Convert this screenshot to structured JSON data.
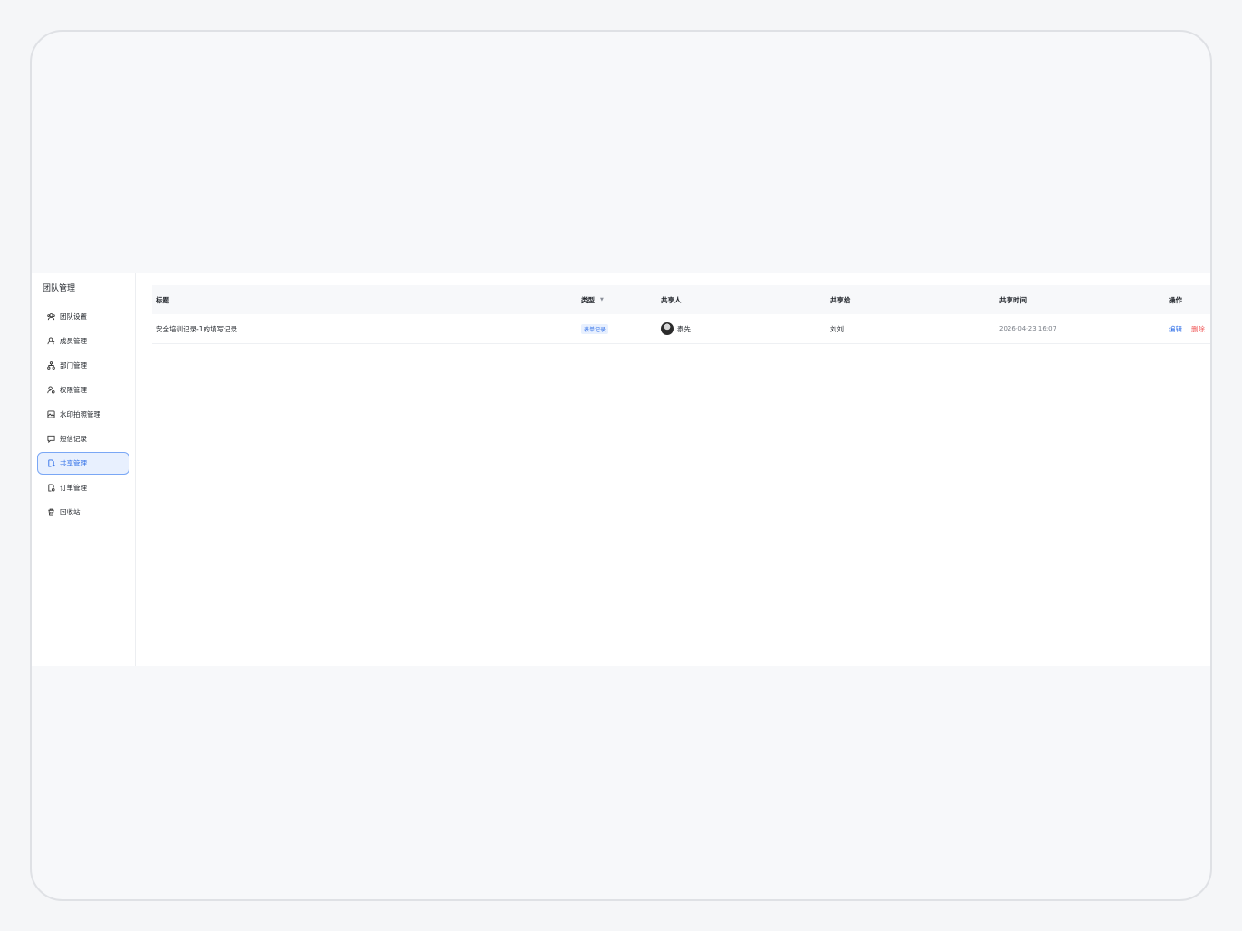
{
  "sidebar": {
    "title": "团队管理",
    "items": [
      {
        "label": "团队设置",
        "icon": "team-settings-icon"
      },
      {
        "label": "成员管理",
        "icon": "members-icon"
      },
      {
        "label": "部门管理",
        "icon": "department-icon"
      },
      {
        "label": "权限管理",
        "icon": "permission-icon"
      },
      {
        "label": "水印拍照管理",
        "icon": "watermark-photo-icon"
      },
      {
        "label": "短信记录",
        "icon": "message-icon"
      },
      {
        "label": "共享管理",
        "icon": "share-doc-icon",
        "active": true
      },
      {
        "label": "订单管理",
        "icon": "order-doc-icon"
      },
      {
        "label": "回收站",
        "icon": "recycle-bin-icon"
      }
    ]
  },
  "table": {
    "columns": [
      "标题",
      "类型",
      "共享人",
      "共享给",
      "共享时间",
      "操作"
    ],
    "rows": [
      {
        "title": "安全培训记录-1的填写记录",
        "type": "表单记录",
        "sharer": "泰先",
        "shared_to": "刘刘",
        "time": "2026-04-23 16:07",
        "edit": "编辑",
        "delete": "删除"
      }
    ]
  },
  "colors": {
    "accent": "#2f6fe8",
    "danger": "#f05a5a",
    "active_bg": "#e8f0fe"
  }
}
